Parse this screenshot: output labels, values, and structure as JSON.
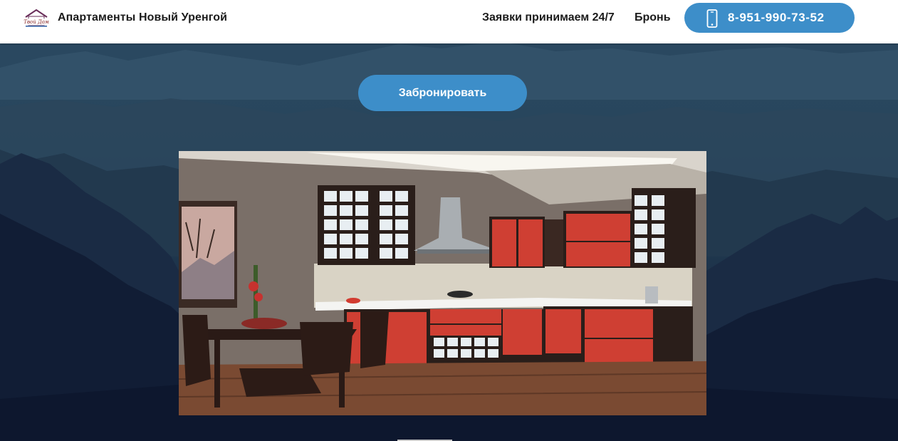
{
  "header": {
    "site_title": "Апартаменты Новый Уренгой",
    "logo_alt": "Твой Дом",
    "nav": {
      "applications_label": "Заявки принимаем 24/7",
      "booking_label": "Бронь"
    },
    "phone": "8-951-990-73-52",
    "phone_icon": "phone-icon"
  },
  "hero": {
    "book_button_label": "Забронировать",
    "photo_subject": "kitchen-photo"
  },
  "colors": {
    "accent": "#3d8ec9",
    "header_bg": "#ffffff",
    "text": "#1b1b1b"
  }
}
